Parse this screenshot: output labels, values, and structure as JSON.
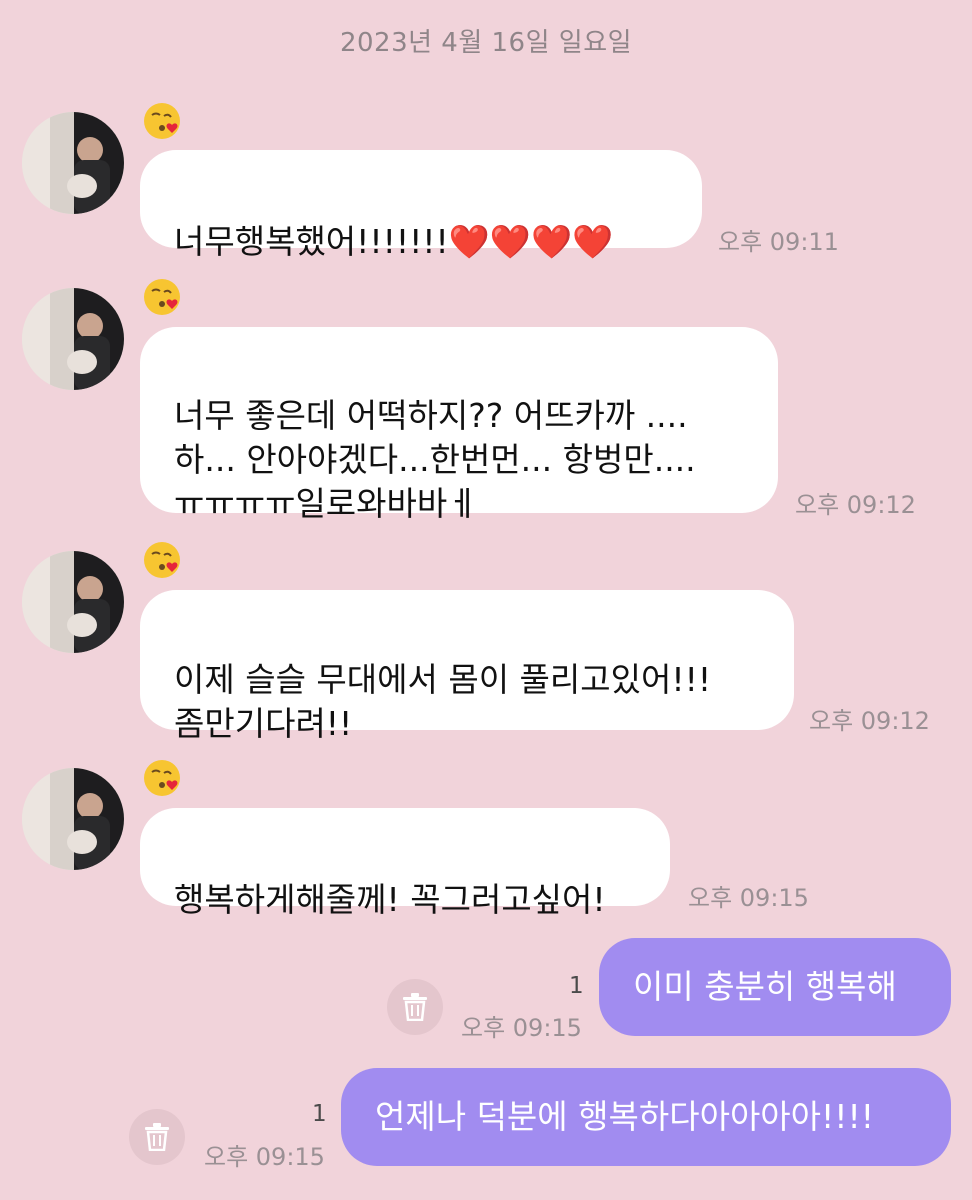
{
  "date_header": "2023년 4월 16일 일요일",
  "received": [
    {
      "emoji": "kissing-heart-emoji",
      "text": "너무행복했어!!!!!!!❤️❤️❤️❤️",
      "time": "오후 09:11"
    },
    {
      "emoji": "kissing-heart-emoji",
      "text": "너무 좋은데 어떡하지?? 어뜨카까 ....\n하... 안아야겠다...한번먼... 항벙만....\nㅠㅠㅠㅠ일로와바바ㅔ",
      "time": "오후 09:12"
    },
    {
      "emoji": "kissing-heart-emoji",
      "text": "이제 슬슬 무대에서 몸이 풀리고있어!!!\n좀만기다려!!",
      "time": "오후 09:12"
    },
    {
      "emoji": "kissing-heart-emoji",
      "text": "행복하게해줄께! 꼭그러고싶어!",
      "time": "오후 09:15"
    }
  ],
  "sent": [
    {
      "text": "이미 충분히 행복해",
      "time": "오후 09:15",
      "unread": "1"
    },
    {
      "text": "언제나 덕분에 행복하다아아아아!!!!",
      "time": "오후 09:15",
      "unread": "1"
    }
  ],
  "colors": {
    "background": "#f1d3da",
    "received_bubble": "#ffffff",
    "sent_bubble": "#a18cf0",
    "timestamp": "#9a9094"
  }
}
